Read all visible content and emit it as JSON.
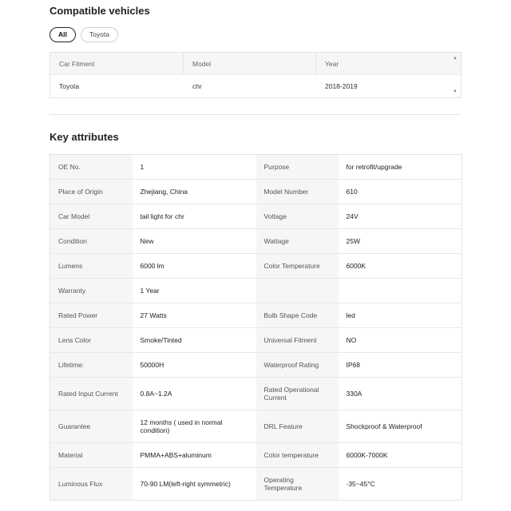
{
  "compatible": {
    "title": "Compatible vehicles",
    "filters": [
      {
        "label": "All",
        "active": true
      },
      {
        "label": "Toyota",
        "active": false
      }
    ],
    "table": {
      "headers": [
        "Car Fitment",
        "Model",
        "Year"
      ],
      "rows": [
        [
          "Toyota",
          "chr",
          "2018-2019"
        ]
      ]
    },
    "scroll_up_icon": "▲",
    "scroll_down_icon": "▼"
  },
  "attributes": {
    "title": "Key attributes",
    "rows": [
      {
        "k1": "OE No.",
        "v1": "1",
        "k2": "Purpose",
        "v2": "for retrofit/upgrade"
      },
      {
        "k1": "Place of Origin",
        "v1": "Zhejiang, China",
        "k2": "Model Number",
        "v2": "610"
      },
      {
        "k1": "Car Model",
        "v1": "tail light for chr",
        "k2": "Voltage",
        "v2": "24V"
      },
      {
        "k1": "Condition",
        "v1": "New",
        "k2": "Wattage",
        "v2": "25W"
      },
      {
        "k1": "Lumens",
        "v1": "6000 lm",
        "k2": "Color Temperature",
        "v2": "6000K"
      },
      {
        "k1": "Warranty",
        "v1": "1 Year",
        "k2": "",
        "v2": ""
      },
      {
        "k1": "Rated Power",
        "v1": "27 Watts",
        "k2": "Bulb Shape Code",
        "v2": "led"
      },
      {
        "k1": "Lens Color",
        "v1": "Smoke/Tinted",
        "k2": "Universal Fitment",
        "v2": "NO"
      },
      {
        "k1": "Lifetime:",
        "v1": "50000H",
        "k2": "Waterproof Rating",
        "v2": "IP68"
      },
      {
        "k1": "Rated Input Current",
        "v1": "0.8A~1.2A",
        "k2": "Rated Operational Current",
        "v2": "330A"
      },
      {
        "k1": "Guarantee",
        "v1": "12 months ( used in normal condition)",
        "k2": "DRL Feature",
        "v2": "Shockproof & Waterproof"
      },
      {
        "k1": "Material",
        "v1": "PMMA+ABS+aluminum",
        "k2": "Color temperature",
        "v2": "6000K-7000K"
      },
      {
        "k1": "Luminous Flux",
        "v1": "70-90 LM(left-right symmetric)",
        "k2": "Operating Temperature",
        "v2": "-35~45°C"
      }
    ]
  }
}
